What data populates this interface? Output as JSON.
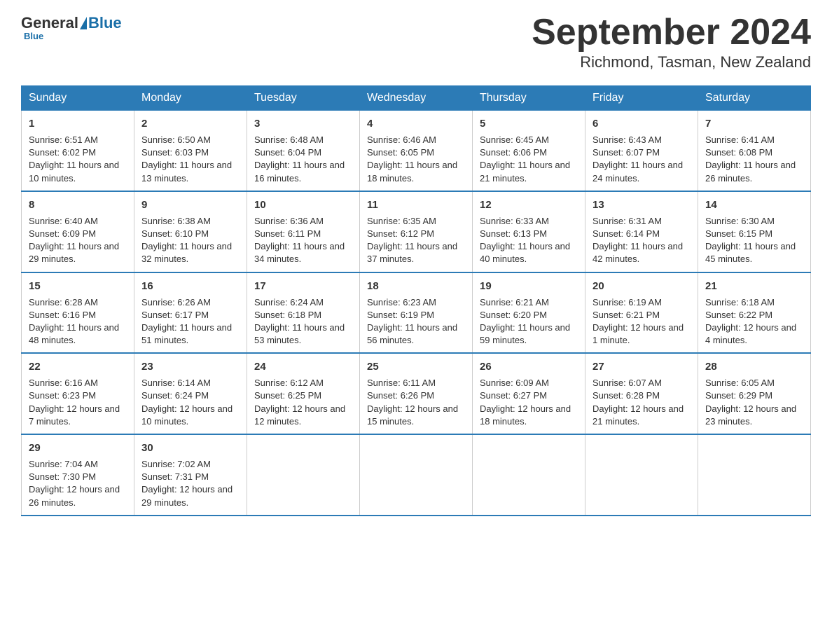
{
  "header": {
    "logo_general": "General",
    "logo_blue": "Blue",
    "month_title": "September 2024",
    "location": "Richmond, Tasman, New Zealand"
  },
  "days_of_week": [
    "Sunday",
    "Monday",
    "Tuesday",
    "Wednesday",
    "Thursday",
    "Friday",
    "Saturday"
  ],
  "weeks": [
    [
      {
        "num": "1",
        "sunrise": "6:51 AM",
        "sunset": "6:02 PM",
        "daylight": "11 hours and 10 minutes."
      },
      {
        "num": "2",
        "sunrise": "6:50 AM",
        "sunset": "6:03 PM",
        "daylight": "11 hours and 13 minutes."
      },
      {
        "num": "3",
        "sunrise": "6:48 AM",
        "sunset": "6:04 PM",
        "daylight": "11 hours and 16 minutes."
      },
      {
        "num": "4",
        "sunrise": "6:46 AM",
        "sunset": "6:05 PM",
        "daylight": "11 hours and 18 minutes."
      },
      {
        "num": "5",
        "sunrise": "6:45 AM",
        "sunset": "6:06 PM",
        "daylight": "11 hours and 21 minutes."
      },
      {
        "num": "6",
        "sunrise": "6:43 AM",
        "sunset": "6:07 PM",
        "daylight": "11 hours and 24 minutes."
      },
      {
        "num": "7",
        "sunrise": "6:41 AM",
        "sunset": "6:08 PM",
        "daylight": "11 hours and 26 minutes."
      }
    ],
    [
      {
        "num": "8",
        "sunrise": "6:40 AM",
        "sunset": "6:09 PM",
        "daylight": "11 hours and 29 minutes."
      },
      {
        "num": "9",
        "sunrise": "6:38 AM",
        "sunset": "6:10 PM",
        "daylight": "11 hours and 32 minutes."
      },
      {
        "num": "10",
        "sunrise": "6:36 AM",
        "sunset": "6:11 PM",
        "daylight": "11 hours and 34 minutes."
      },
      {
        "num": "11",
        "sunrise": "6:35 AM",
        "sunset": "6:12 PM",
        "daylight": "11 hours and 37 minutes."
      },
      {
        "num": "12",
        "sunrise": "6:33 AM",
        "sunset": "6:13 PM",
        "daylight": "11 hours and 40 minutes."
      },
      {
        "num": "13",
        "sunrise": "6:31 AM",
        "sunset": "6:14 PM",
        "daylight": "11 hours and 42 minutes."
      },
      {
        "num": "14",
        "sunrise": "6:30 AM",
        "sunset": "6:15 PM",
        "daylight": "11 hours and 45 minutes."
      }
    ],
    [
      {
        "num": "15",
        "sunrise": "6:28 AM",
        "sunset": "6:16 PM",
        "daylight": "11 hours and 48 minutes."
      },
      {
        "num": "16",
        "sunrise": "6:26 AM",
        "sunset": "6:17 PM",
        "daylight": "11 hours and 51 minutes."
      },
      {
        "num": "17",
        "sunrise": "6:24 AM",
        "sunset": "6:18 PM",
        "daylight": "11 hours and 53 minutes."
      },
      {
        "num": "18",
        "sunrise": "6:23 AM",
        "sunset": "6:19 PM",
        "daylight": "11 hours and 56 minutes."
      },
      {
        "num": "19",
        "sunrise": "6:21 AM",
        "sunset": "6:20 PM",
        "daylight": "11 hours and 59 minutes."
      },
      {
        "num": "20",
        "sunrise": "6:19 AM",
        "sunset": "6:21 PM",
        "daylight": "12 hours and 1 minute."
      },
      {
        "num": "21",
        "sunrise": "6:18 AM",
        "sunset": "6:22 PM",
        "daylight": "12 hours and 4 minutes."
      }
    ],
    [
      {
        "num": "22",
        "sunrise": "6:16 AM",
        "sunset": "6:23 PM",
        "daylight": "12 hours and 7 minutes."
      },
      {
        "num": "23",
        "sunrise": "6:14 AM",
        "sunset": "6:24 PM",
        "daylight": "12 hours and 10 minutes."
      },
      {
        "num": "24",
        "sunrise": "6:12 AM",
        "sunset": "6:25 PM",
        "daylight": "12 hours and 12 minutes."
      },
      {
        "num": "25",
        "sunrise": "6:11 AM",
        "sunset": "6:26 PM",
        "daylight": "12 hours and 15 minutes."
      },
      {
        "num": "26",
        "sunrise": "6:09 AM",
        "sunset": "6:27 PM",
        "daylight": "12 hours and 18 minutes."
      },
      {
        "num": "27",
        "sunrise": "6:07 AM",
        "sunset": "6:28 PM",
        "daylight": "12 hours and 21 minutes."
      },
      {
        "num": "28",
        "sunrise": "6:05 AM",
        "sunset": "6:29 PM",
        "daylight": "12 hours and 23 minutes."
      }
    ],
    [
      {
        "num": "29",
        "sunrise": "7:04 AM",
        "sunset": "7:30 PM",
        "daylight": "12 hours and 26 minutes."
      },
      {
        "num": "30",
        "sunrise": "7:02 AM",
        "sunset": "7:31 PM",
        "daylight": "12 hours and 29 minutes."
      },
      null,
      null,
      null,
      null,
      null
    ]
  ]
}
